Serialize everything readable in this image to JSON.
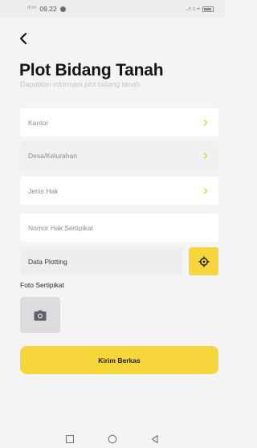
{
  "status_bar": {
    "signal_text": "ᴴᴰ ᵀᴬᴸ",
    "time": "09.22",
    "right_text": "⎇ ≡ ••"
  },
  "header": {
    "back_icon": "chevron-left-icon",
    "title": "Plot Bidang Tanah",
    "subtitle": "Dapatkan informasi plot bidang tanah"
  },
  "form": {
    "kantor": "Kantor",
    "desa": "Desa/Kelurahan",
    "jenis_hak": "Jenis Hak",
    "nomor_hak": "Nomor Hak Sertipikat",
    "data_plotting": "Data Plotting",
    "foto_label": "Foto Sertipikat",
    "submit": "Kirim Berkas"
  },
  "colors": {
    "accent": "#f6d63a",
    "chevron": "#f1c827",
    "background": "#f4f4f6"
  }
}
